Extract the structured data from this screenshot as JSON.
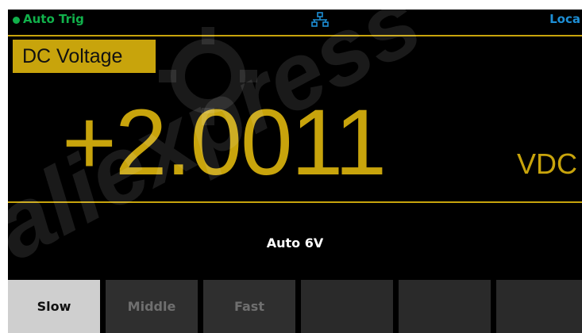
{
  "status": {
    "trigger": "Auto Trig",
    "network_icon": "lan-icon",
    "remote": "Loca"
  },
  "display": {
    "function": "DC Voltage",
    "reading": "+2.0011",
    "unit": "VDC",
    "range": "Auto 6V"
  },
  "softkeys": [
    {
      "label": "Slow",
      "selected": true
    },
    {
      "label": "Middle",
      "selected": false
    },
    {
      "label": "Fast",
      "selected": false
    },
    {
      "label": "",
      "selected": false
    },
    {
      "label": "",
      "selected": false
    },
    {
      "label": "",
      "selected": false
    }
  ],
  "watermark": "aliexpress",
  "colors": {
    "accent": "#c8a40c",
    "trigger": "#11b14b",
    "remote": "#1d8fd6",
    "background": "#000000"
  }
}
